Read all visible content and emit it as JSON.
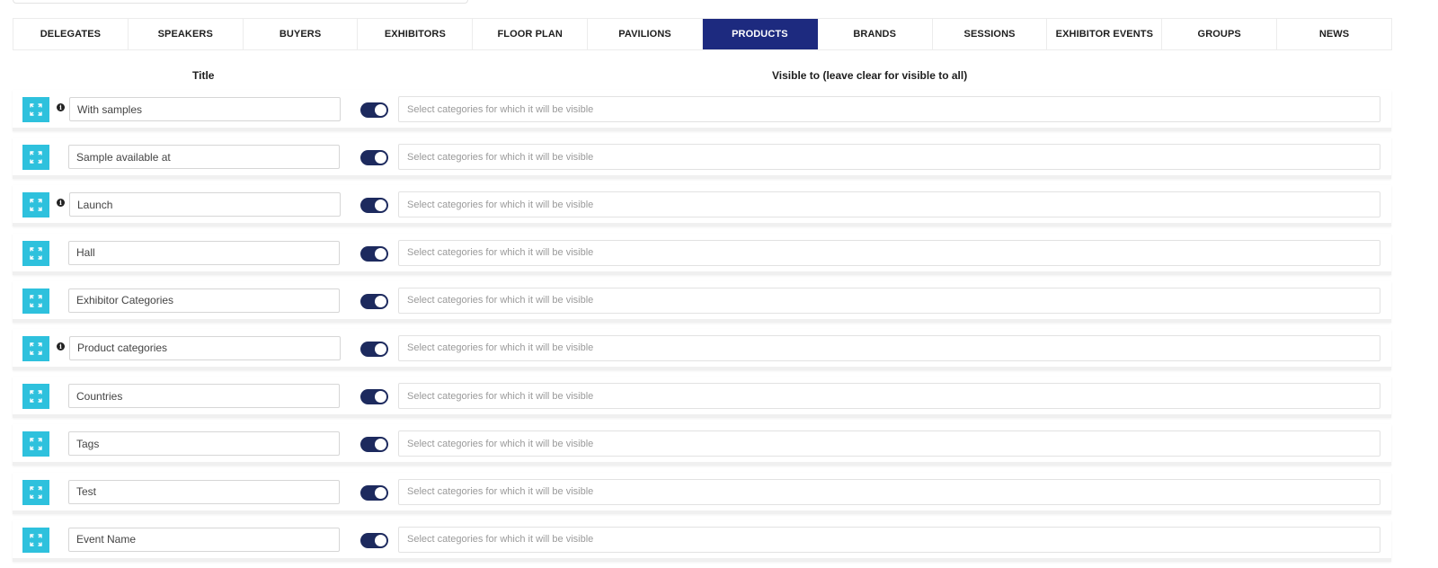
{
  "tabs": [
    {
      "label": "DELEGATES",
      "active": false
    },
    {
      "label": "SPEAKERS",
      "active": false
    },
    {
      "label": "BUYERS",
      "active": false
    },
    {
      "label": "EXHIBITORS",
      "active": false
    },
    {
      "label": "FLOOR PLAN",
      "active": false
    },
    {
      "label": "PAVILIONS",
      "active": false
    },
    {
      "label": "PRODUCTS",
      "active": true
    },
    {
      "label": "BRANDS",
      "active": false
    },
    {
      "label": "SESSIONS",
      "active": false
    },
    {
      "label": "EXHIBITOR EVENTS",
      "active": false
    },
    {
      "label": "GROUPS",
      "active": false
    },
    {
      "label": "NEWS",
      "active": false
    }
  ],
  "columns": {
    "title": "Title",
    "visible_to": "Visible to (leave clear for visible to all)"
  },
  "visible_placeholder": "Select categories for which it will be visible",
  "accent_color": "#2ec1dd",
  "active_tab_color": "#1d2a7f",
  "toggle_color": "#1d2a5e",
  "rows": [
    {
      "title": "With samples",
      "info": true,
      "enabled": true
    },
    {
      "title": "Sample available at",
      "info": false,
      "enabled": true
    },
    {
      "title": "Launch",
      "info": true,
      "enabled": true
    },
    {
      "title": "Hall",
      "info": false,
      "enabled": true
    },
    {
      "title": "Exhibitor Categories",
      "info": false,
      "enabled": true
    },
    {
      "title": "Product categories",
      "info": true,
      "enabled": true
    },
    {
      "title": "Countries",
      "info": false,
      "enabled": true
    },
    {
      "title": "Tags",
      "info": false,
      "enabled": true
    },
    {
      "title": "Test",
      "info": false,
      "enabled": true
    },
    {
      "title": "Event Name",
      "info": false,
      "enabled": true
    }
  ]
}
